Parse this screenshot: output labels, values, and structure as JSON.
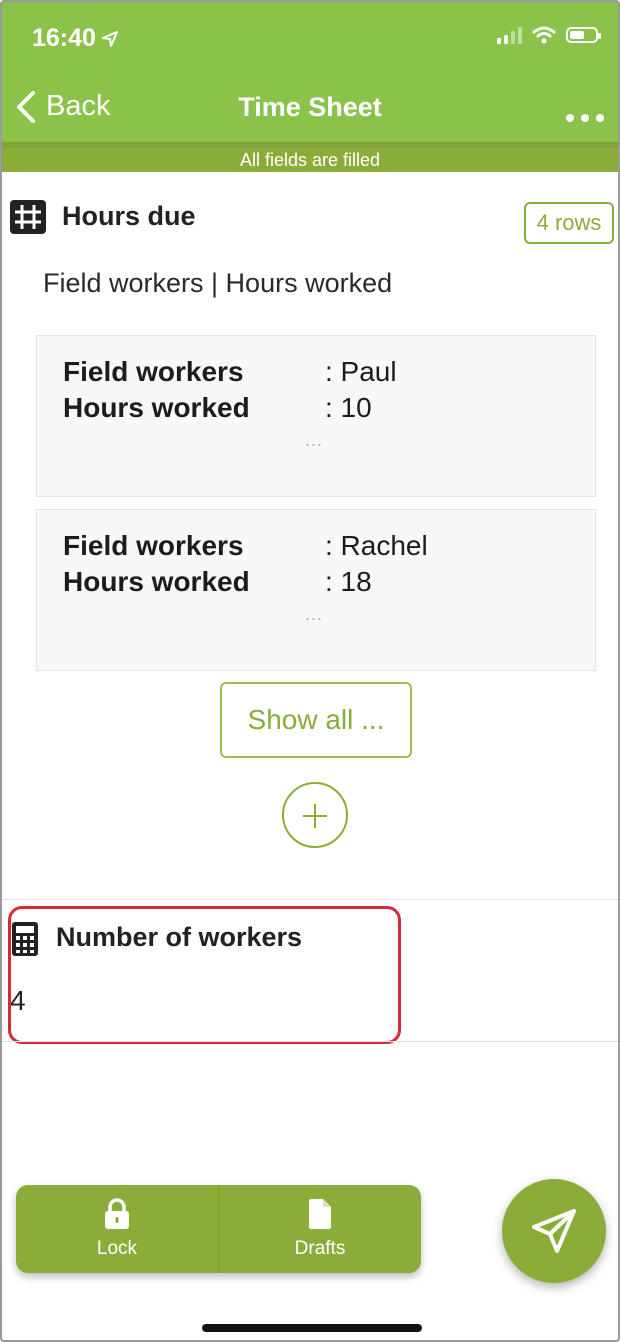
{
  "status_bar": {
    "time": "16:40"
  },
  "header": {
    "back_label": "Back",
    "title": "Time Sheet",
    "status_message": "All fields are filled"
  },
  "hours_due": {
    "title": "Hours due",
    "rows_badge": "4 rows",
    "columns_caption": "Field workers | Hours worked",
    "rows": [
      {
        "field_label": "Field workers",
        "field_value": ": Paul",
        "hours_label": "Hours worked",
        "hours_value": ": 10",
        "more": "..."
      },
      {
        "field_label": "Field workers",
        "field_value": ": Rachel",
        "hours_label": "Hours worked",
        "hours_value": ": 18",
        "more": "..."
      }
    ],
    "show_all_label": "Show all ..."
  },
  "number_of_workers": {
    "title": "Number of workers",
    "value": "4"
  },
  "toolbar": {
    "lock_label": "Lock",
    "drafts_label": "Drafts"
  },
  "colors": {
    "header": "#8bc34a",
    "accent": "#8aad3a",
    "highlight": "#d42a3a"
  },
  "icons": [
    "location-arrow-icon",
    "signal-icon",
    "wifi-icon",
    "battery-icon",
    "chevron-left-icon",
    "more-icon",
    "table-grid-icon",
    "plus-icon",
    "calculator-icon",
    "lock-icon",
    "document-icon",
    "send-icon"
  ]
}
